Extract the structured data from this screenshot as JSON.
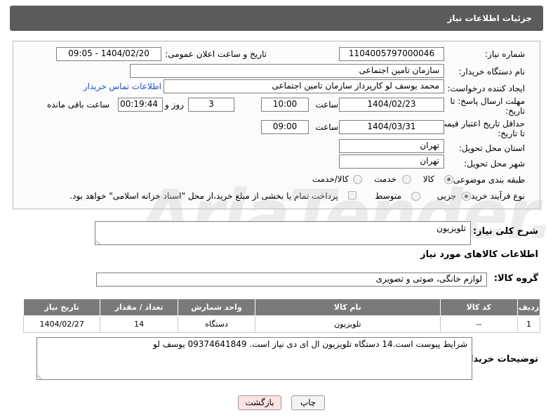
{
  "header": {
    "title": "جزئیات اطلاعات نیاز"
  },
  "form": {
    "need_number": {
      "label": "شماره نیاز:",
      "value": "1104005797000046"
    },
    "announce_datetime": {
      "label": "تاریخ و ساعت اعلان عمومی:",
      "value": "1404/02/20 - 09:05"
    },
    "buyer_org": {
      "label": "نام دستگاه خریدار:",
      "value": "سازمان تامین اجتماعی"
    },
    "requester": {
      "label": "ایجاد کننده درخواست:",
      "value": "محمد یوسف لو کارپرداز سازمان تامین اجتماعی",
      "contact_link": "اطلاعات تماس خریدار"
    },
    "reply_deadline": {
      "label_line1": "مهلت ارسال پاسخ: تا",
      "label_line2": "تاریخ:",
      "date": "1404/02/23",
      "time_label": "ساعت",
      "time": "10:00",
      "days": "3",
      "days_label": "روز و",
      "remaining": "00:19:44",
      "remaining_label": "ساعت باقی مانده"
    },
    "price_validity": {
      "label_line1": "حداقل تاریخ اعتبار قیمت:",
      "label_line2": "تا تاریخ:",
      "date": "1404/03/31",
      "time_label": "ساعت",
      "time": "09:00"
    },
    "delivery_province": {
      "label": "استان محل تحویل:",
      "value": "تهران"
    },
    "delivery_city": {
      "label": "شهر محل تحویل:",
      "value": "تهران"
    },
    "category": {
      "label": "طبقه بندی موضوعی:",
      "options": [
        "کالا",
        "خدمت",
        "کالا/خدمت"
      ],
      "selected_index": 0
    },
    "process_type": {
      "label": "نوع فرآیند خرید :",
      "options": [
        "جزیی",
        "متوسط"
      ],
      "selected_index": 0,
      "payment_note": "پرداخت تمام یا بخشی از مبلغ خرید،از محل \"اسناد خزانه اسلامی\" خواهد بود."
    }
  },
  "summary": {
    "label": "شرح کلی نیاز:",
    "value": "تلویزیون"
  },
  "goods_section": {
    "title": "اطلاعات کالاهای مورد نیاز",
    "group_label": "گروه کالا:",
    "group_value": "لوازم خانگی، صوتی و تصویری"
  },
  "items_table": {
    "headers": [
      "ردیف",
      "کد کالا",
      "نام کالا",
      "واحد شمارش",
      "تعداد / مقدار",
      "تاریخ نیاز"
    ],
    "rows": [
      [
        "1",
        "--",
        "تلویزیون",
        "دستگاه",
        "14",
        "1404/02/27"
      ]
    ]
  },
  "buyer_notes": {
    "label": "توضیحات خریدار:",
    "value": "شرایط پیوست است.14 دستگاه تلویزیون ال ای دی نیاز است. 09374641849 یوسف لو"
  },
  "buttons": {
    "print": "چاپ",
    "back": "بازگشت"
  },
  "watermark": {
    "text": "AriaTender.net"
  },
  "colors": {
    "header_bg": "#5b5b5b",
    "table_header_bg": "#7a7a7a",
    "link": "#1a55c9",
    "back_button_bg": "#fde3e3"
  }
}
